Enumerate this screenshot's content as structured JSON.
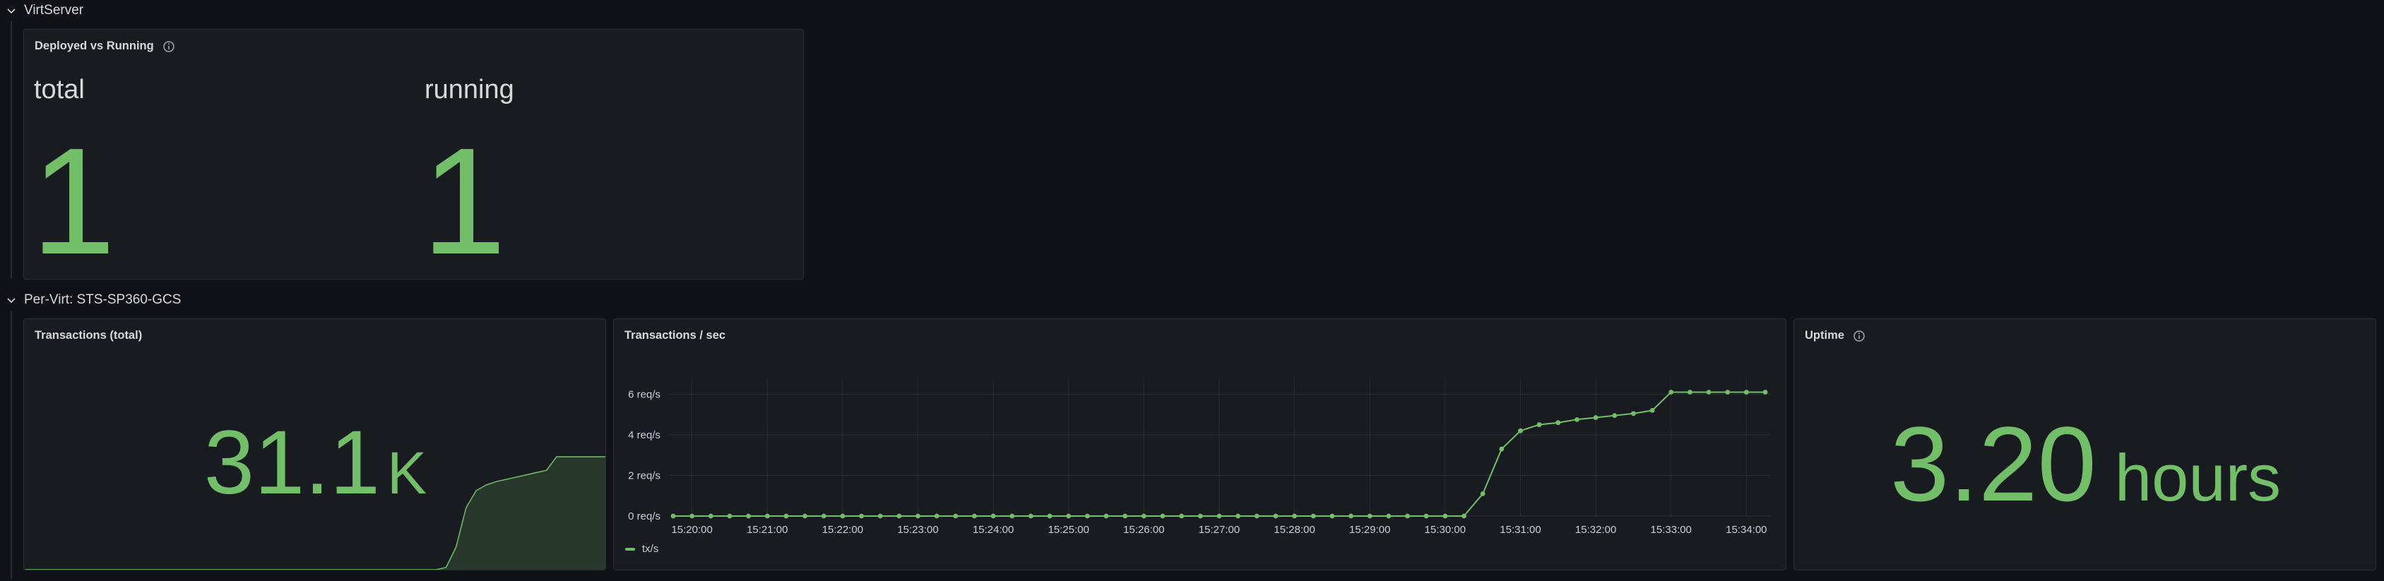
{
  "rows": {
    "virtserver": {
      "title": "VirtServer"
    },
    "pervirt": {
      "title": "Per-Virt: STS-SP360-GCS"
    }
  },
  "panels": {
    "deployed": {
      "title": "Deployed vs Running",
      "stats": [
        {
          "label": "total",
          "value": "1"
        },
        {
          "label": "running",
          "value": "1"
        }
      ]
    },
    "tx_total": {
      "title": "Transactions (total)",
      "value": "31.1",
      "unit": "K"
    },
    "tx_sec": {
      "title": "Transactions / sec",
      "legend": "tx/s"
    },
    "uptime": {
      "title": "Uptime",
      "value": "3.20",
      "unit": "hours"
    }
  },
  "colors": {
    "accent": "#73bf69",
    "panel_bg": "#181b1f",
    "page_bg": "#111217"
  },
  "chart_data": {
    "type": "line",
    "title": "Transactions / sec",
    "series": [
      {
        "name": "tx/s",
        "x": [
          "15:19:45",
          "15:20:00",
          "15:20:15",
          "15:20:30",
          "15:20:45",
          "15:21:00",
          "15:21:15",
          "15:21:30",
          "15:21:45",
          "15:22:00",
          "15:22:15",
          "15:22:30",
          "15:22:45",
          "15:23:00",
          "15:23:15",
          "15:23:30",
          "15:23:45",
          "15:24:00",
          "15:24:15",
          "15:24:30",
          "15:24:45",
          "15:25:00",
          "15:25:15",
          "15:25:30",
          "15:25:45",
          "15:26:00",
          "15:26:15",
          "15:26:30",
          "15:26:45",
          "15:27:00",
          "15:27:15",
          "15:27:30",
          "15:27:45",
          "15:28:00",
          "15:28:15",
          "15:28:30",
          "15:28:45",
          "15:29:00",
          "15:29:15",
          "15:29:30",
          "15:29:45",
          "15:30:00",
          "15:30:15",
          "15:30:30",
          "15:30:45",
          "15:31:00",
          "15:31:15",
          "15:31:30",
          "15:31:45",
          "15:32:00",
          "15:32:15",
          "15:32:30",
          "15:32:45",
          "15:33:00",
          "15:33:15",
          "15:33:30",
          "15:33:45",
          "15:34:00",
          "15:34:15"
        ],
        "values": [
          0,
          0,
          0,
          0,
          0,
          0,
          0,
          0,
          0,
          0,
          0,
          0,
          0,
          0,
          0,
          0,
          0,
          0,
          0,
          0,
          0,
          0,
          0,
          0,
          0,
          0,
          0,
          0,
          0,
          0,
          0,
          0,
          0,
          0,
          0,
          0,
          0,
          0,
          0,
          0,
          0,
          0,
          0,
          1.1,
          3.3,
          4.2,
          4.5,
          4.6,
          4.75,
          4.85,
          4.95,
          5.05,
          5.2,
          6.1,
          6.1,
          6.1,
          6.1,
          6.1,
          6.1
        ]
      }
    ],
    "yticks": [
      "0 req/s",
      "2 req/s",
      "4 req/s",
      "6 req/s"
    ],
    "ylim": [
      0,
      6.5
    ],
    "xticks": [
      "15:20:00",
      "15:21:00",
      "15:22:00",
      "15:23:00",
      "15:24:00",
      "15:25:00",
      "15:26:00",
      "15:27:00",
      "15:28:00",
      "15:29:00",
      "15:30:00",
      "15:31:00",
      "15:32:00",
      "15:33:00",
      "15:34:00"
    ],
    "grid": true,
    "legend": "bottom-left"
  },
  "sparkline": {
    "type": "area",
    "values": [
      0,
      0,
      0,
      0,
      0,
      0,
      0,
      0,
      0,
      0,
      0,
      0,
      0,
      0,
      0,
      0,
      0,
      0,
      0,
      0,
      0,
      0,
      0,
      0,
      0,
      0,
      0,
      0,
      0,
      0,
      0,
      0,
      0,
      0,
      0,
      0,
      0,
      0,
      0,
      0,
      0,
      0,
      0.02,
      0.2,
      0.55,
      0.7,
      0.75,
      0.78,
      0.8,
      0.82,
      0.84,
      0.86,
      0.88,
      1,
      1,
      1,
      1,
      1,
      1
    ]
  }
}
